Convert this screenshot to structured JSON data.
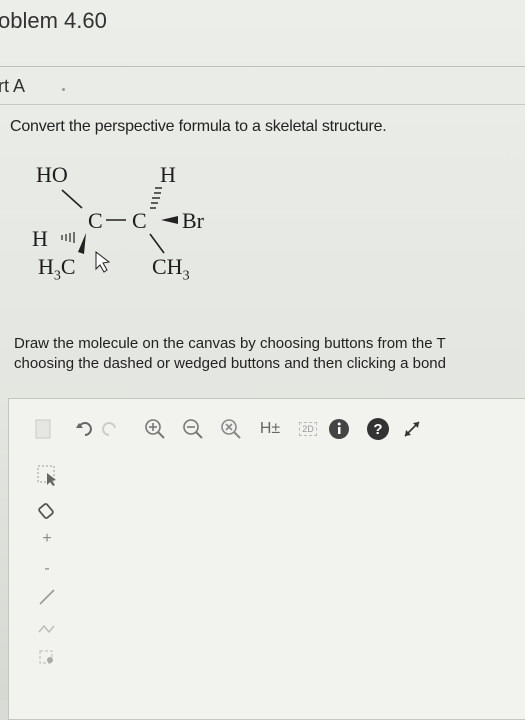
{
  "header": {
    "problem_title": "oblem 4.60",
    "part_label": "rt A"
  },
  "question": {
    "prompt": "Convert the perspective formula to a skeletal structure."
  },
  "molecule": {
    "labels": {
      "ho": "HO",
      "h_top": "H",
      "c1": "C",
      "c2": "C",
      "br": "Br",
      "h_left": "H",
      "h3c": "H",
      "h3c_sub": "3",
      "h3c_c": "C",
      "ch3": "CH",
      "ch3_sub": "3"
    }
  },
  "instructions": {
    "line1": "Draw the molecule on the canvas by choosing buttons from the T",
    "line2": "choosing the dashed or wedged buttons and then clicking a bond"
  },
  "toolbar": {
    "h_toggle_label": "H±",
    "twod_label": "2D",
    "help_label": "?"
  },
  "side_tools": {
    "plus_label": "+",
    "minus_label": "-"
  }
}
